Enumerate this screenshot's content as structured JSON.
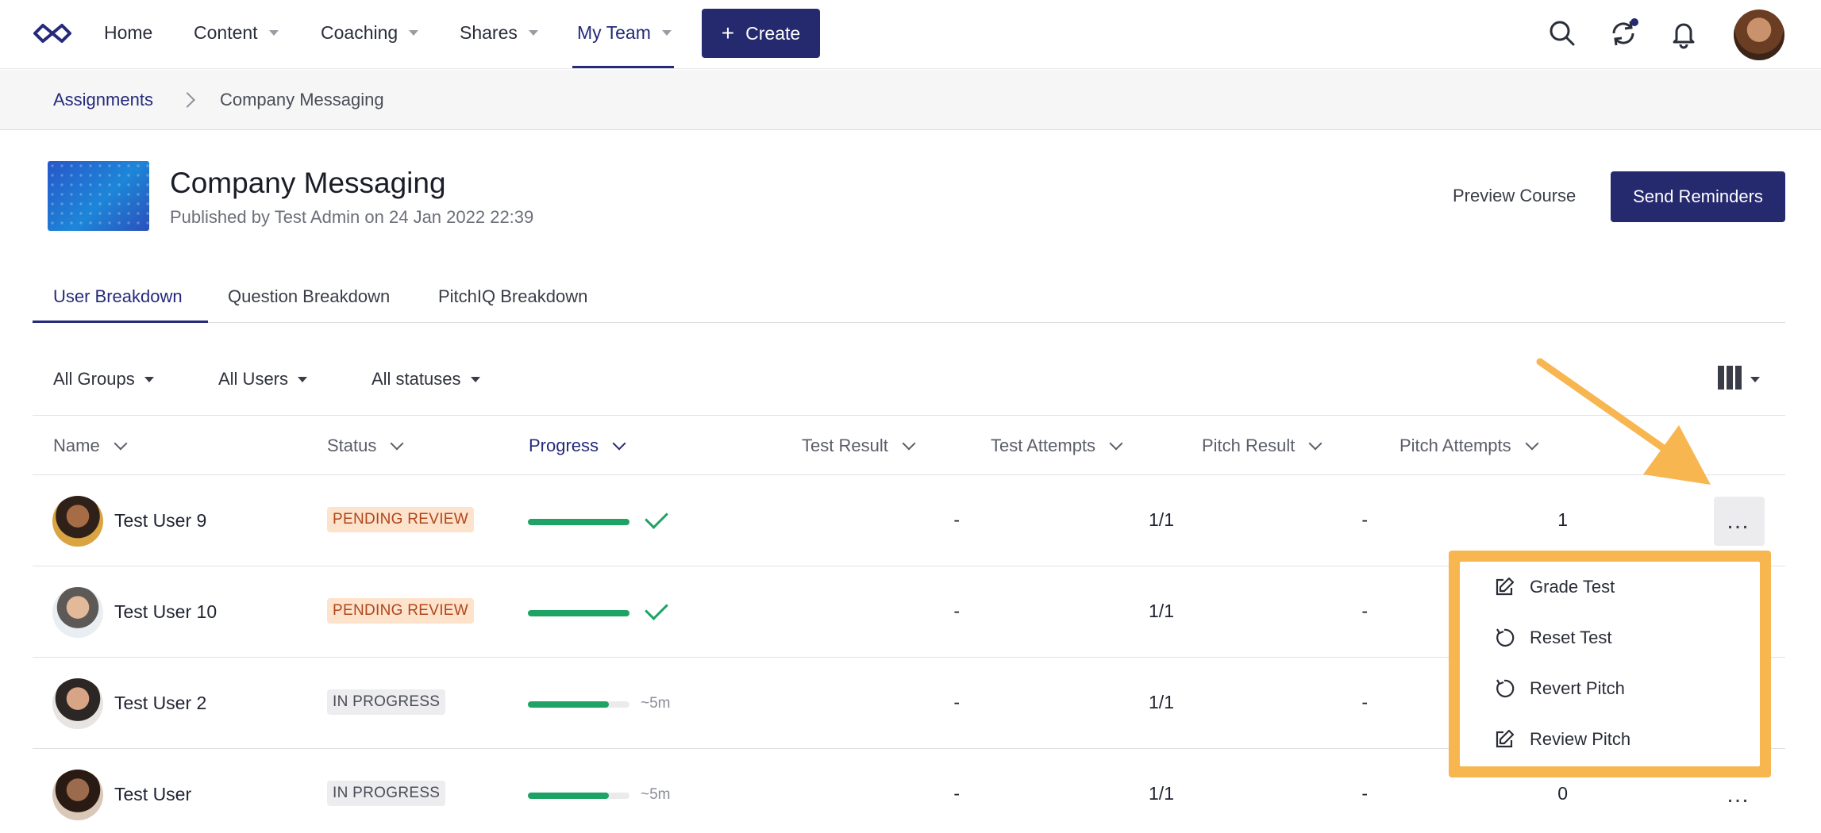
{
  "nav": {
    "items": [
      {
        "label": "Home"
      },
      {
        "label": "Content"
      },
      {
        "label": "Coaching"
      },
      {
        "label": "Shares"
      },
      {
        "label": "My Team"
      }
    ],
    "create_label": "Create",
    "create_icon": "plus-icon",
    "accent": "#25296e"
  },
  "breadcrumb": {
    "parent": "Assignments",
    "current": "Company Messaging"
  },
  "course": {
    "title": "Company Messaging",
    "subtitle": "Published by Test Admin on 24 Jan 2022 22:39",
    "preview_label": "Preview Course",
    "send_label": "Send Reminders"
  },
  "tabs": [
    {
      "label": "User Breakdown"
    },
    {
      "label": "Question Breakdown"
    },
    {
      "label": "PitchIQ Breakdown"
    }
  ],
  "filters": {
    "groups": "All Groups",
    "users": "All Users",
    "statuses": "All statuses"
  },
  "table": {
    "headers": [
      "Name",
      "Status",
      "Progress",
      "Test Result",
      "Test Attempts",
      "Pitch Result",
      "Pitch Attempts"
    ],
    "rows": [
      {
        "name": "Test User 9",
        "status": "PENDING REVIEW",
        "progress": 1.0,
        "progress_label": "",
        "test_result": "-",
        "test_attempts": "1/1",
        "pitch_result": "-",
        "pitch_attempts": "1"
      },
      {
        "name": "Test User 10",
        "status": "PENDING REVIEW",
        "progress": 1.0,
        "progress_label": "",
        "test_result": "-",
        "test_attempts": "1/1",
        "pitch_result": "-",
        "pitch_attempts": ""
      },
      {
        "name": "Test User 2",
        "status": "IN PROGRESS",
        "progress": 0.8,
        "progress_label": "~5m",
        "test_result": "-",
        "test_attempts": "1/1",
        "pitch_result": "-",
        "pitch_attempts": ""
      },
      {
        "name": "Test User",
        "status": "IN PROGRESS",
        "progress": 0.8,
        "progress_label": "~5m",
        "test_result": "-",
        "test_attempts": "1/1",
        "pitch_result": "-",
        "pitch_attempts": "0"
      }
    ],
    "more_label": "…"
  },
  "menu": {
    "items": [
      {
        "label": "Grade Test",
        "icon": "edit-icon"
      },
      {
        "label": "Reset Test",
        "icon": "reset-icon"
      },
      {
        "label": "Revert Pitch",
        "icon": "reset-icon"
      },
      {
        "label": "Review Pitch",
        "icon": "edit-icon"
      }
    ]
  },
  "colors": {
    "pending_bg": "#fde2cc",
    "pending_text": "#b0461b",
    "progress": "#1fa365",
    "highlight": "#f7b64f"
  }
}
